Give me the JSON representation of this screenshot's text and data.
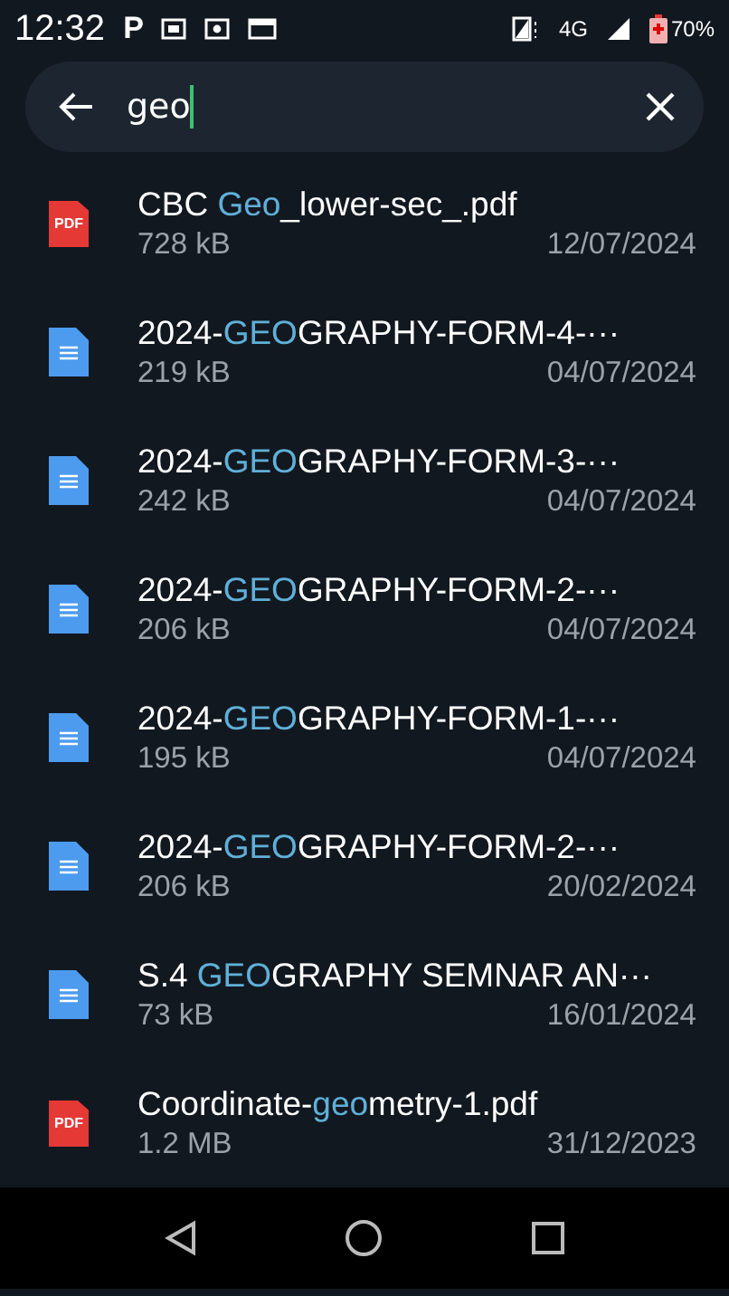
{
  "status_bar": {
    "time": "12:32",
    "notification_letter": "P",
    "network": "4G",
    "battery": "70%"
  },
  "search": {
    "value": "geo"
  },
  "files": [
    {
      "kind": "pdf",
      "icon_text": "PDF",
      "name": {
        "before": "CBC ",
        "match": "Geo",
        "after": "_lower-sec_.pdf"
      },
      "size": "728 kB",
      "date": "12/07/2024"
    },
    {
      "kind": "doc",
      "name": {
        "before": "2024-",
        "match": "GEO",
        "after": "GRAPHY-FORM-4-···"
      },
      "size": "219 kB",
      "date": "04/07/2024"
    },
    {
      "kind": "doc",
      "name": {
        "before": "2024-",
        "match": "GEO",
        "after": "GRAPHY-FORM-3-···"
      },
      "size": "242 kB",
      "date": "04/07/2024"
    },
    {
      "kind": "doc",
      "name": {
        "before": "2024-",
        "match": "GEO",
        "after": "GRAPHY-FORM-2-···"
      },
      "size": "206 kB",
      "date": "04/07/2024"
    },
    {
      "kind": "doc",
      "name": {
        "before": "2024-",
        "match": "GEO",
        "after": "GRAPHY-FORM-1-···"
      },
      "size": "195 kB",
      "date": "04/07/2024"
    },
    {
      "kind": "doc",
      "name": {
        "before": "2024-",
        "match": "GEO",
        "after": "GRAPHY-FORM-2-···"
      },
      "size": "206 kB",
      "date": "20/02/2024"
    },
    {
      "kind": "doc",
      "name": {
        "before": "S.4 ",
        "match": "GEO",
        "after": "GRAPHY SEMNAR AN···"
      },
      "size": "73 kB",
      "date": "16/01/2024"
    },
    {
      "kind": "pdf",
      "icon_text": "PDF",
      "name": {
        "before": "Coordinate-",
        "match": "geo",
        "after": "metry-1.pdf"
      },
      "size": "1.2 MB",
      "date": "31/12/2023"
    }
  ]
}
